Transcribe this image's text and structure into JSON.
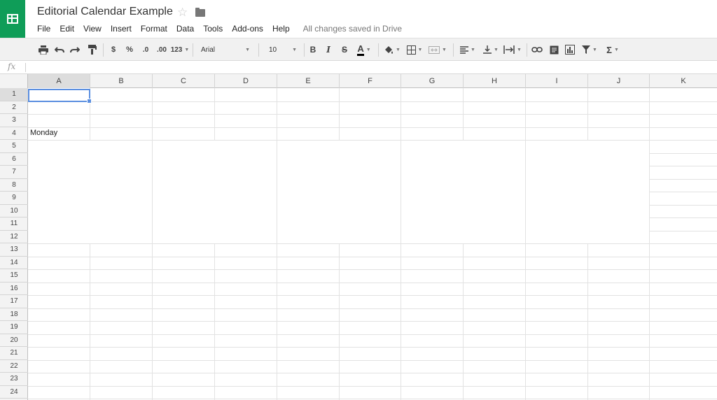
{
  "header": {
    "title": "Editorial Calendar Example",
    "app_icon": "sheets-icon",
    "star_icon": "star-outline-icon",
    "folder_icon": "folder-icon",
    "star_glyph": "☆"
  },
  "menubar": {
    "items": [
      "File",
      "Edit",
      "View",
      "Insert",
      "Format",
      "Data",
      "Tools",
      "Add-ons",
      "Help"
    ],
    "status": "All changes saved in Drive"
  },
  "toolbar": {
    "currency": "$",
    "percent": "%",
    "decrease_decimal": ".0",
    "increase_decimal": ".00",
    "number_format": "123",
    "font": "Arial",
    "font_size": "10",
    "bold": "B",
    "italic": "I",
    "strikethrough": "S",
    "text_color": "A",
    "sum": "Σ"
  },
  "formula_bar": {
    "fx_label": "fx",
    "value": ""
  },
  "grid": {
    "columns": [
      "A",
      "B",
      "C",
      "D",
      "E",
      "F",
      "G",
      "H",
      "I",
      "J",
      "K"
    ],
    "rows": [
      "1",
      "2",
      "3",
      "4",
      "5",
      "6",
      "7",
      "8",
      "9",
      "10",
      "11",
      "12",
      "13",
      "14",
      "15",
      "16",
      "17",
      "18",
      "19",
      "20",
      "21",
      "22",
      "23",
      "24"
    ],
    "selected_cell": "A1",
    "cells": {
      "A4": "Monday"
    },
    "merged_blocks": [
      "A5:B12",
      "C5:D12",
      "E5:F12",
      "G5:H12",
      "I5:J12"
    ]
  },
  "colors": {
    "brand_green": "#0f9d58",
    "selection_blue": "#5b8fe0"
  }
}
